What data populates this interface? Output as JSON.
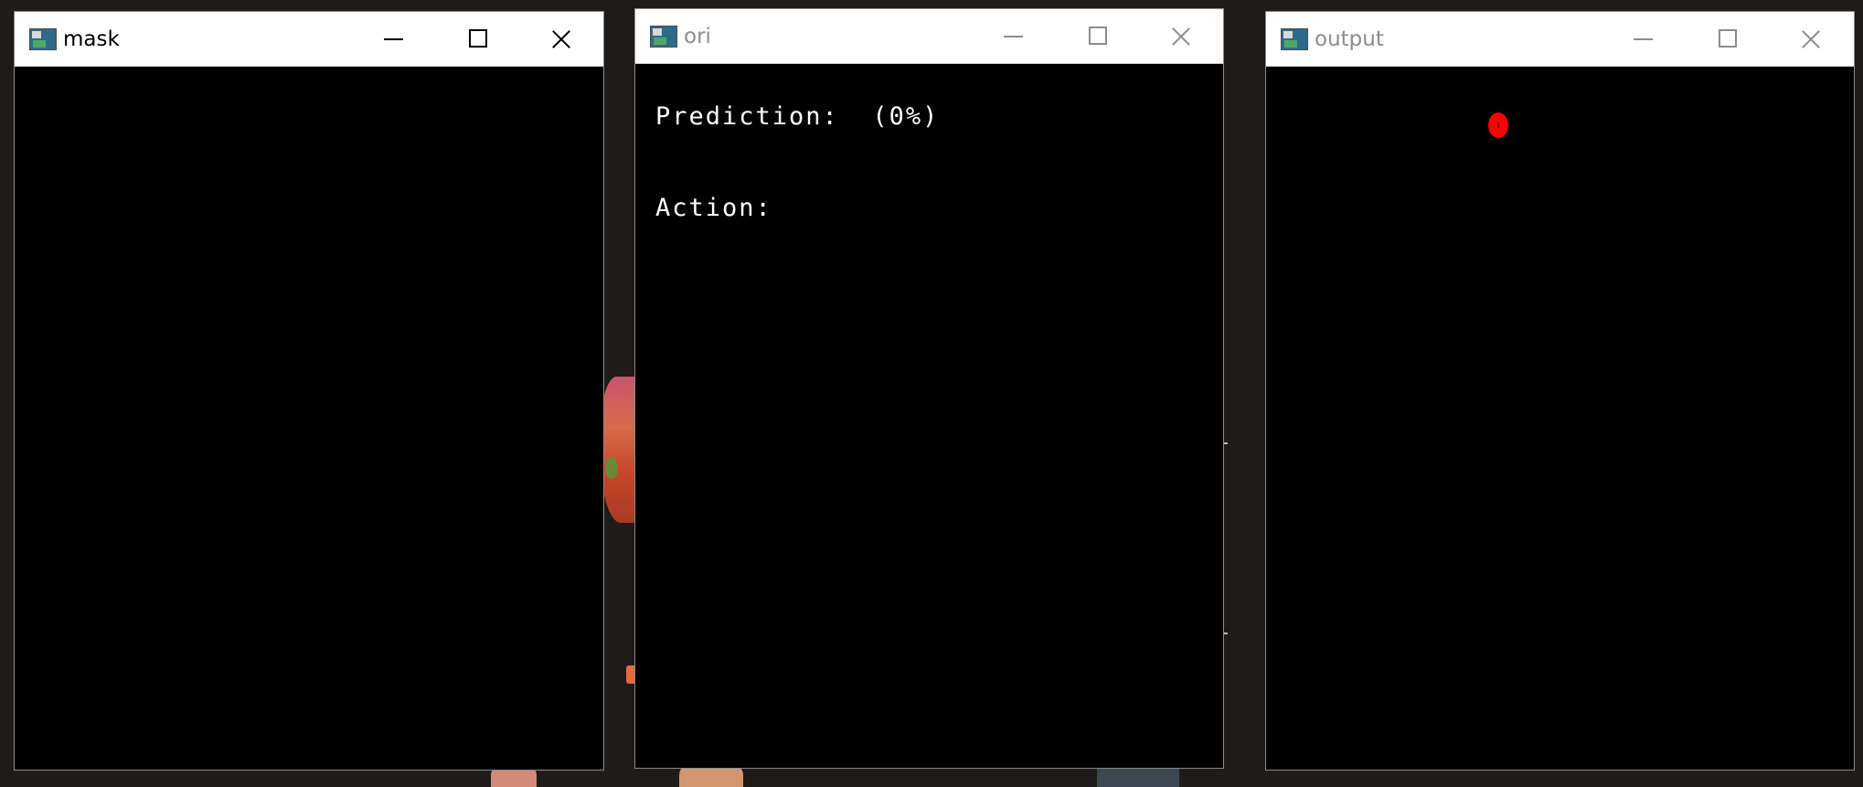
{
  "windows": [
    {
      "id": "mask",
      "title": "mask",
      "active": true,
      "icon": "opencv-window-icon"
    },
    {
      "id": "ori",
      "title": "ori",
      "active": false,
      "icon": "opencv-window-icon",
      "overlay": {
        "prediction_label": "Prediction:  (0%)",
        "action_label": "Action:"
      }
    },
    {
      "id": "output",
      "title": "output",
      "active": false,
      "icon": "opencv-window-icon",
      "marker": {
        "color": "#ff0000",
        "shape": "dot"
      }
    }
  ],
  "controls": {
    "minimize_icon": "minimize-icon",
    "maximize_icon": "maximize-icon",
    "close_icon": "close-icon"
  },
  "colors": {
    "desktop": "#1e1b18",
    "client_background": "#000000",
    "overlay_text": "#ffffff",
    "marker": "#ff0000"
  }
}
